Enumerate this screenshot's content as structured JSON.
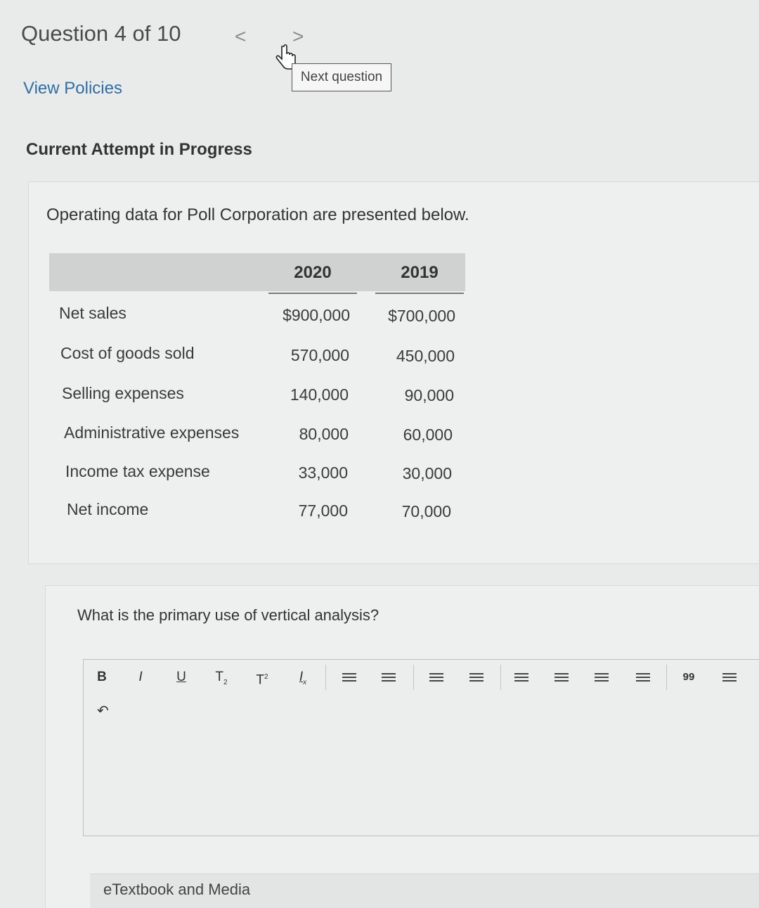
{
  "header": {
    "question_counter": "Question 4 of 10",
    "prev_glyph": "<",
    "next_glyph": ">",
    "next_tooltip": "Next question",
    "view_policies": "View Policies",
    "attempt_status": "Current Attempt in Progress"
  },
  "problem": {
    "intro": "Operating data for Poll Corporation are presented below.",
    "table": {
      "columns": [
        "2020",
        "2019"
      ],
      "rows": [
        {
          "label": "Net sales",
          "values": [
            "$900,000",
            "$700,000"
          ]
        },
        {
          "label": "Cost of goods sold",
          "values": [
            "570,000",
            "450,000"
          ]
        },
        {
          "label": "Selling expenses",
          "values": [
            "140,000",
            "90,000"
          ]
        },
        {
          "label": "Administrative expenses",
          "values": [
            "80,000",
            "60,000"
          ]
        },
        {
          "label": "Income tax expense",
          "values": [
            "33,000",
            "30,000"
          ]
        },
        {
          "label": "Net income",
          "values": [
            "77,000",
            "70,000"
          ]
        }
      ]
    }
  },
  "question": {
    "text": "What is the primary use of vertical analysis?",
    "answer_value": ""
  },
  "toolbar": {
    "bold": "B",
    "italic": "I",
    "underline": "U",
    "subscript": "T",
    "superscript": "T",
    "clear_format": "I",
    "blockquote": "99",
    "undo_glyph": "↶"
  },
  "footer": {
    "etextbook": "eTextbook and Media"
  },
  "colors": {
    "link": "#2f6ea8",
    "background": "#e9ebea",
    "table_header": "#d0d2d1"
  }
}
